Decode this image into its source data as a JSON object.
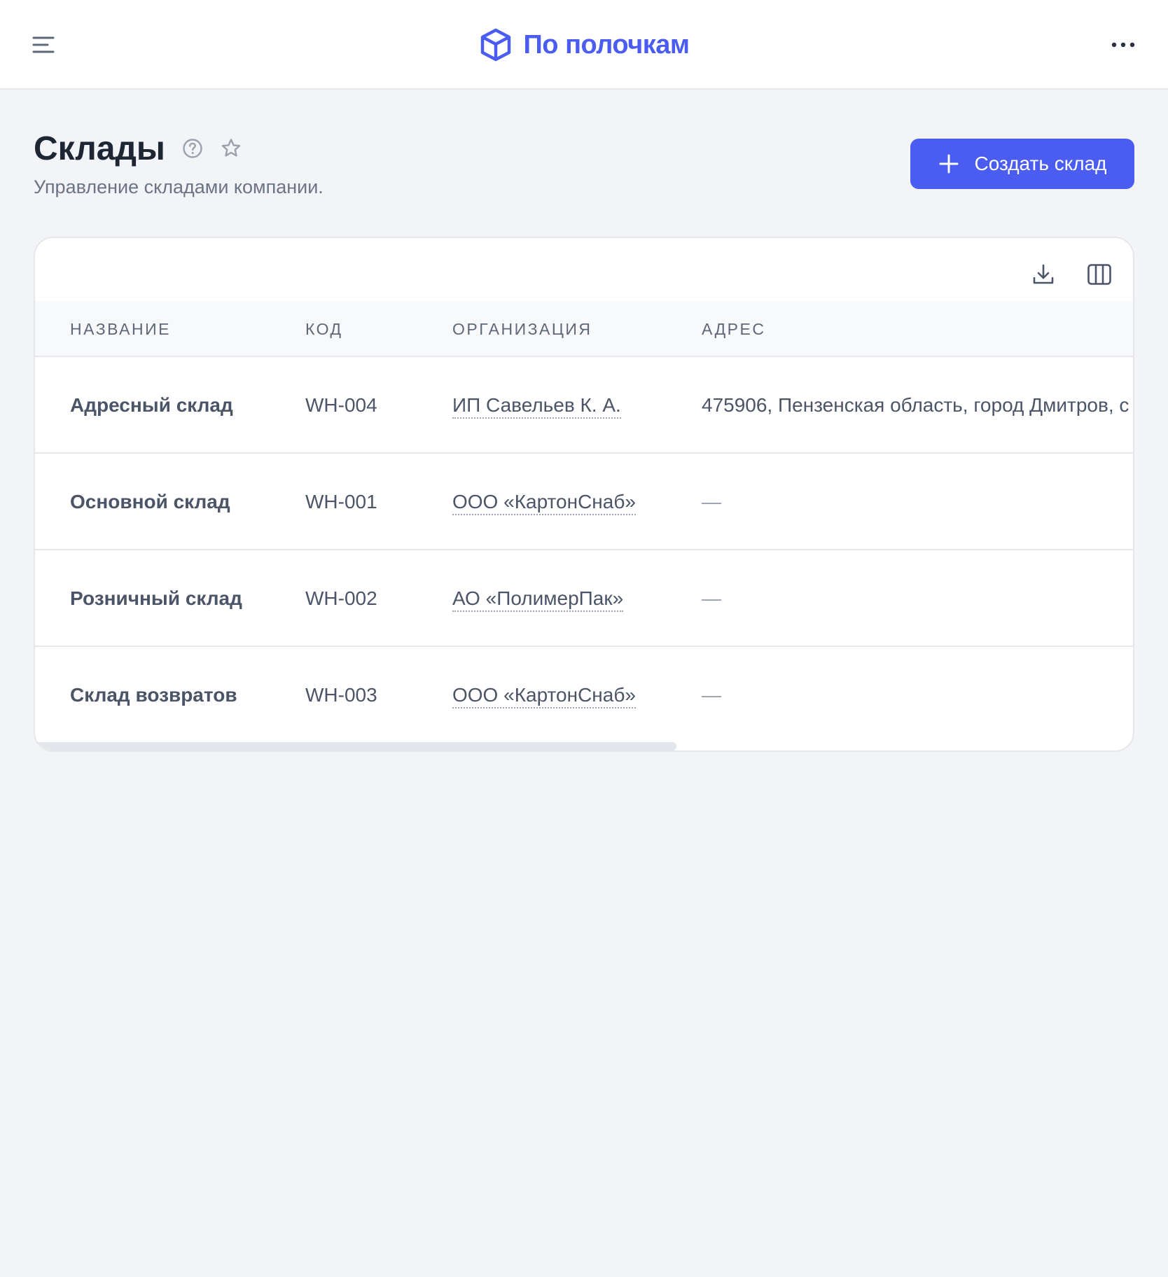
{
  "app": {
    "brand_name": "По полочкам",
    "accent_color": "#4a5df0"
  },
  "header": {
    "menu_icon": "hamburger-icon",
    "more_icon": "more-horizontal-icon"
  },
  "page": {
    "title": "Склады",
    "subtitle": "Управление складами компании.",
    "help_icon": "help-circle-icon",
    "favorite_icon": "star-icon",
    "create_button_label": "Создать склад"
  },
  "table": {
    "toolbar": {
      "export_icon": "download-icon",
      "columns_icon": "columns-icon"
    },
    "columns": [
      "НАЗВАНИЕ",
      "КОД",
      "ОРГАНИЗАЦИЯ",
      "АДРЕС"
    ],
    "rows": [
      {
        "name": "Адресный склад",
        "code": "WH-004",
        "organization": "ИП Савельев К. А.",
        "address": "475906, Пензенская область, город Дмитров, с"
      },
      {
        "name": "Основной склад",
        "code": "WH-001",
        "organization": "ООО «КартонСнаб»",
        "address": "—"
      },
      {
        "name": "Розничный склад",
        "code": "WH-002",
        "organization": "АО «ПолимерПак»",
        "address": "—"
      },
      {
        "name": "Склад возвратов",
        "code": "WH-003",
        "organization": "ООО «КартонСнаб»",
        "address": "—"
      }
    ]
  }
}
